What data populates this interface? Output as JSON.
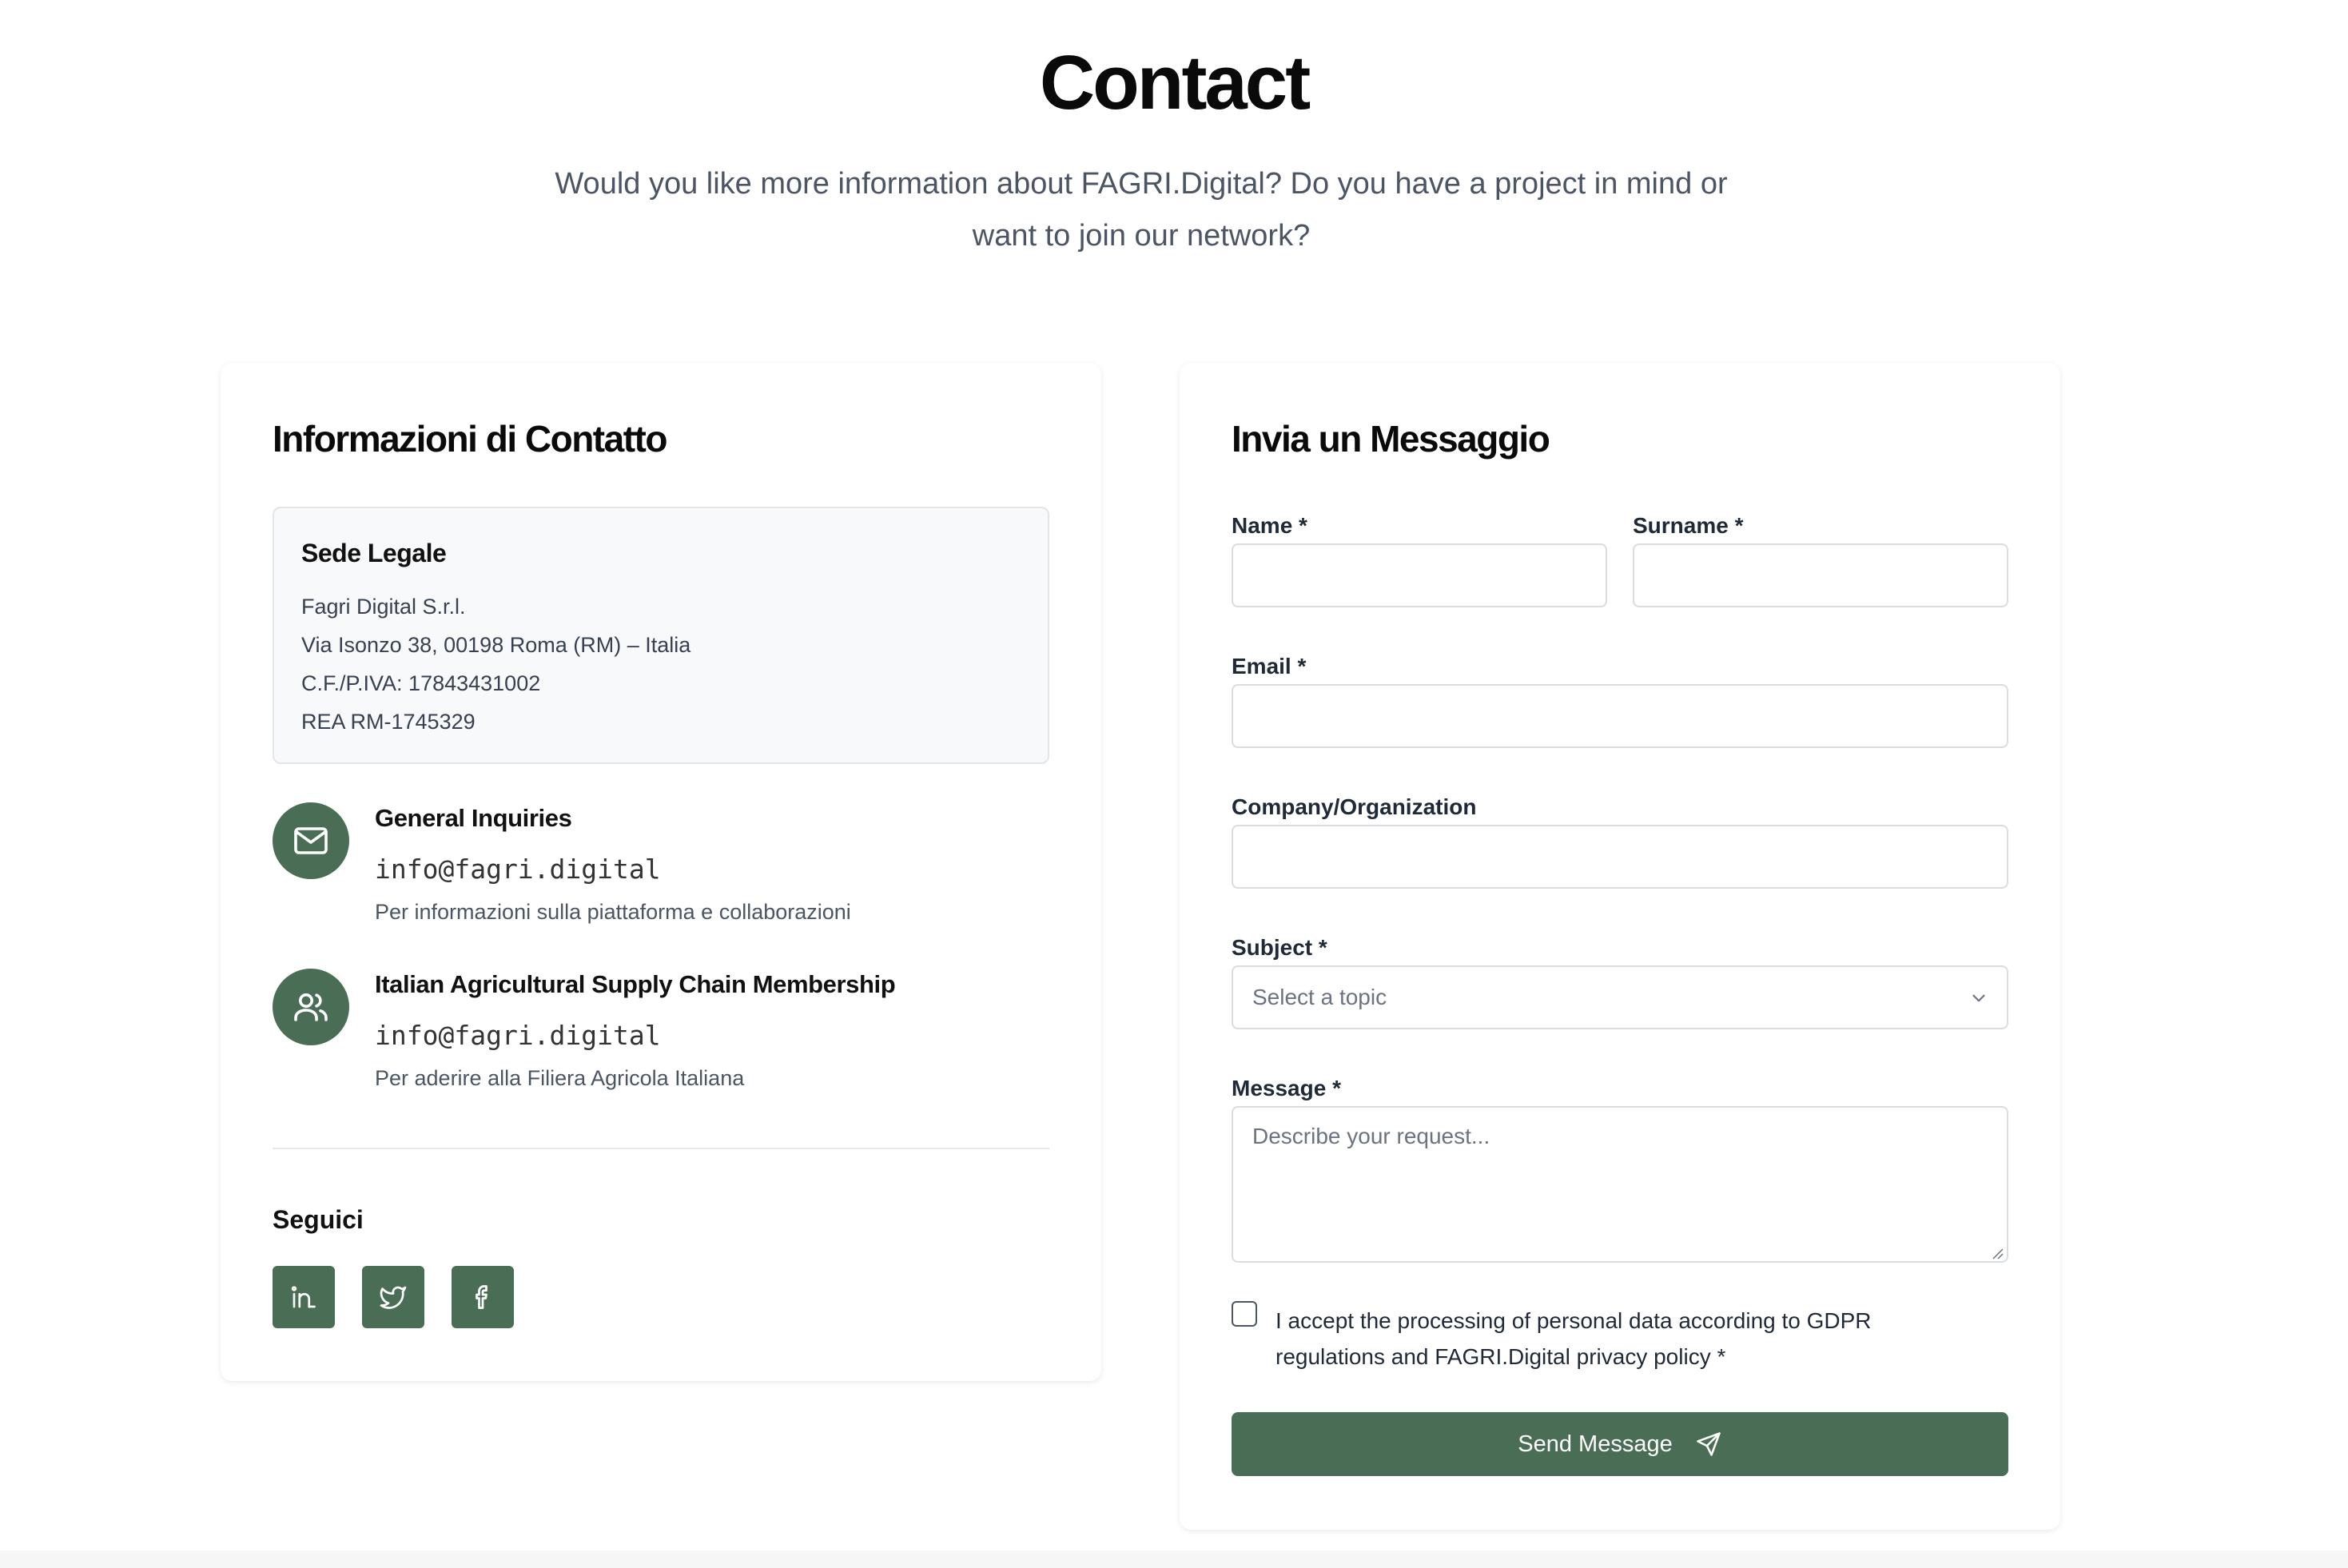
{
  "hero": {
    "title": "Contact",
    "subtitle_line1": "Would you like more information about FAGRI.Digital? Do you have a project in mind or",
    "subtitle_line2": "want to join our network?"
  },
  "contact_info": {
    "title": "Informazioni di Contatto",
    "office": {
      "title": "Sede Legale",
      "company": "Fagri Digital S.r.l.",
      "address": "Via Isonzo 38, 00198 Roma (RM) – Italia",
      "tax_id": "C.F./P.IVA: 17843431002",
      "rea": "REA RM-1745329"
    },
    "items": [
      {
        "icon": "mail-icon",
        "title": "General Inquiries",
        "email": "info@fagri.digital",
        "description": "Per informazioni sulla piattaforma e collaborazioni"
      },
      {
        "icon": "users-icon",
        "title": "Italian Agricultural Supply Chain Membership",
        "email": "info@fagri.digital",
        "description": "Per aderire alla Filiera Agricola Italiana"
      }
    ],
    "follow": {
      "title": "Seguici",
      "socials": [
        "linkedin-icon",
        "twitter-icon",
        "facebook-icon"
      ]
    }
  },
  "form": {
    "title": "Invia un Messaggio",
    "name_label": "Name *",
    "name_value": "",
    "surname_label": "Surname *",
    "surname_value": "",
    "email_label": "Email *",
    "email_value": "",
    "company_label": "Company/Organization",
    "company_value": "",
    "subject_label": "Subject *",
    "subject_placeholder": "Select a topic",
    "message_label": "Message *",
    "message_placeholder": "Describe your request...",
    "consent_line1": "I accept the processing of personal data according to GDPR",
    "consent_line2": "regulations and FAGRI.Digital privacy policy *",
    "consent_checked": false,
    "submit_label": "Send Message"
  },
  "colors": {
    "accent": "#4a6e55",
    "text_muted": "#4b5563",
    "border": "#d9dce1"
  }
}
